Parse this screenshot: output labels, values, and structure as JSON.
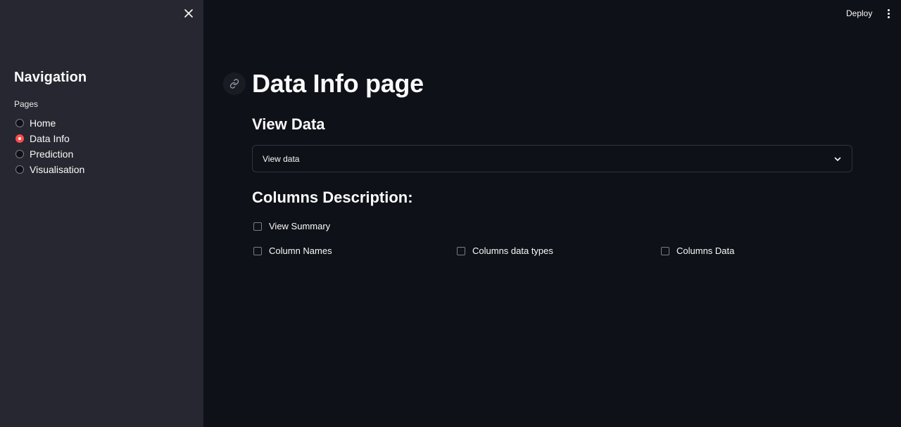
{
  "sidebar": {
    "title": "Navigation",
    "pages_label": "Pages",
    "items": [
      {
        "label": "Home",
        "selected": false
      },
      {
        "label": "Data Info",
        "selected": true
      },
      {
        "label": "Prediction",
        "selected": false
      },
      {
        "label": "Visualisation",
        "selected": false
      }
    ],
    "close_icon": "close-icon"
  },
  "header": {
    "deploy_label": "Deploy",
    "menu_icon": "more-vertical-icon"
  },
  "main": {
    "title": "Data Info page",
    "view_data_heading": "View Data",
    "expander_label": "View data",
    "columns_heading": "Columns Description:",
    "checkboxes": {
      "view_summary": "View Summary",
      "column_names": "Column Names",
      "column_types": "Columns data types",
      "columns_data": "Columns Data"
    }
  },
  "colors": {
    "background": "#0e1117",
    "sidebar": "#262730",
    "accent": "#ff4b4b",
    "text": "#fafafa"
  }
}
